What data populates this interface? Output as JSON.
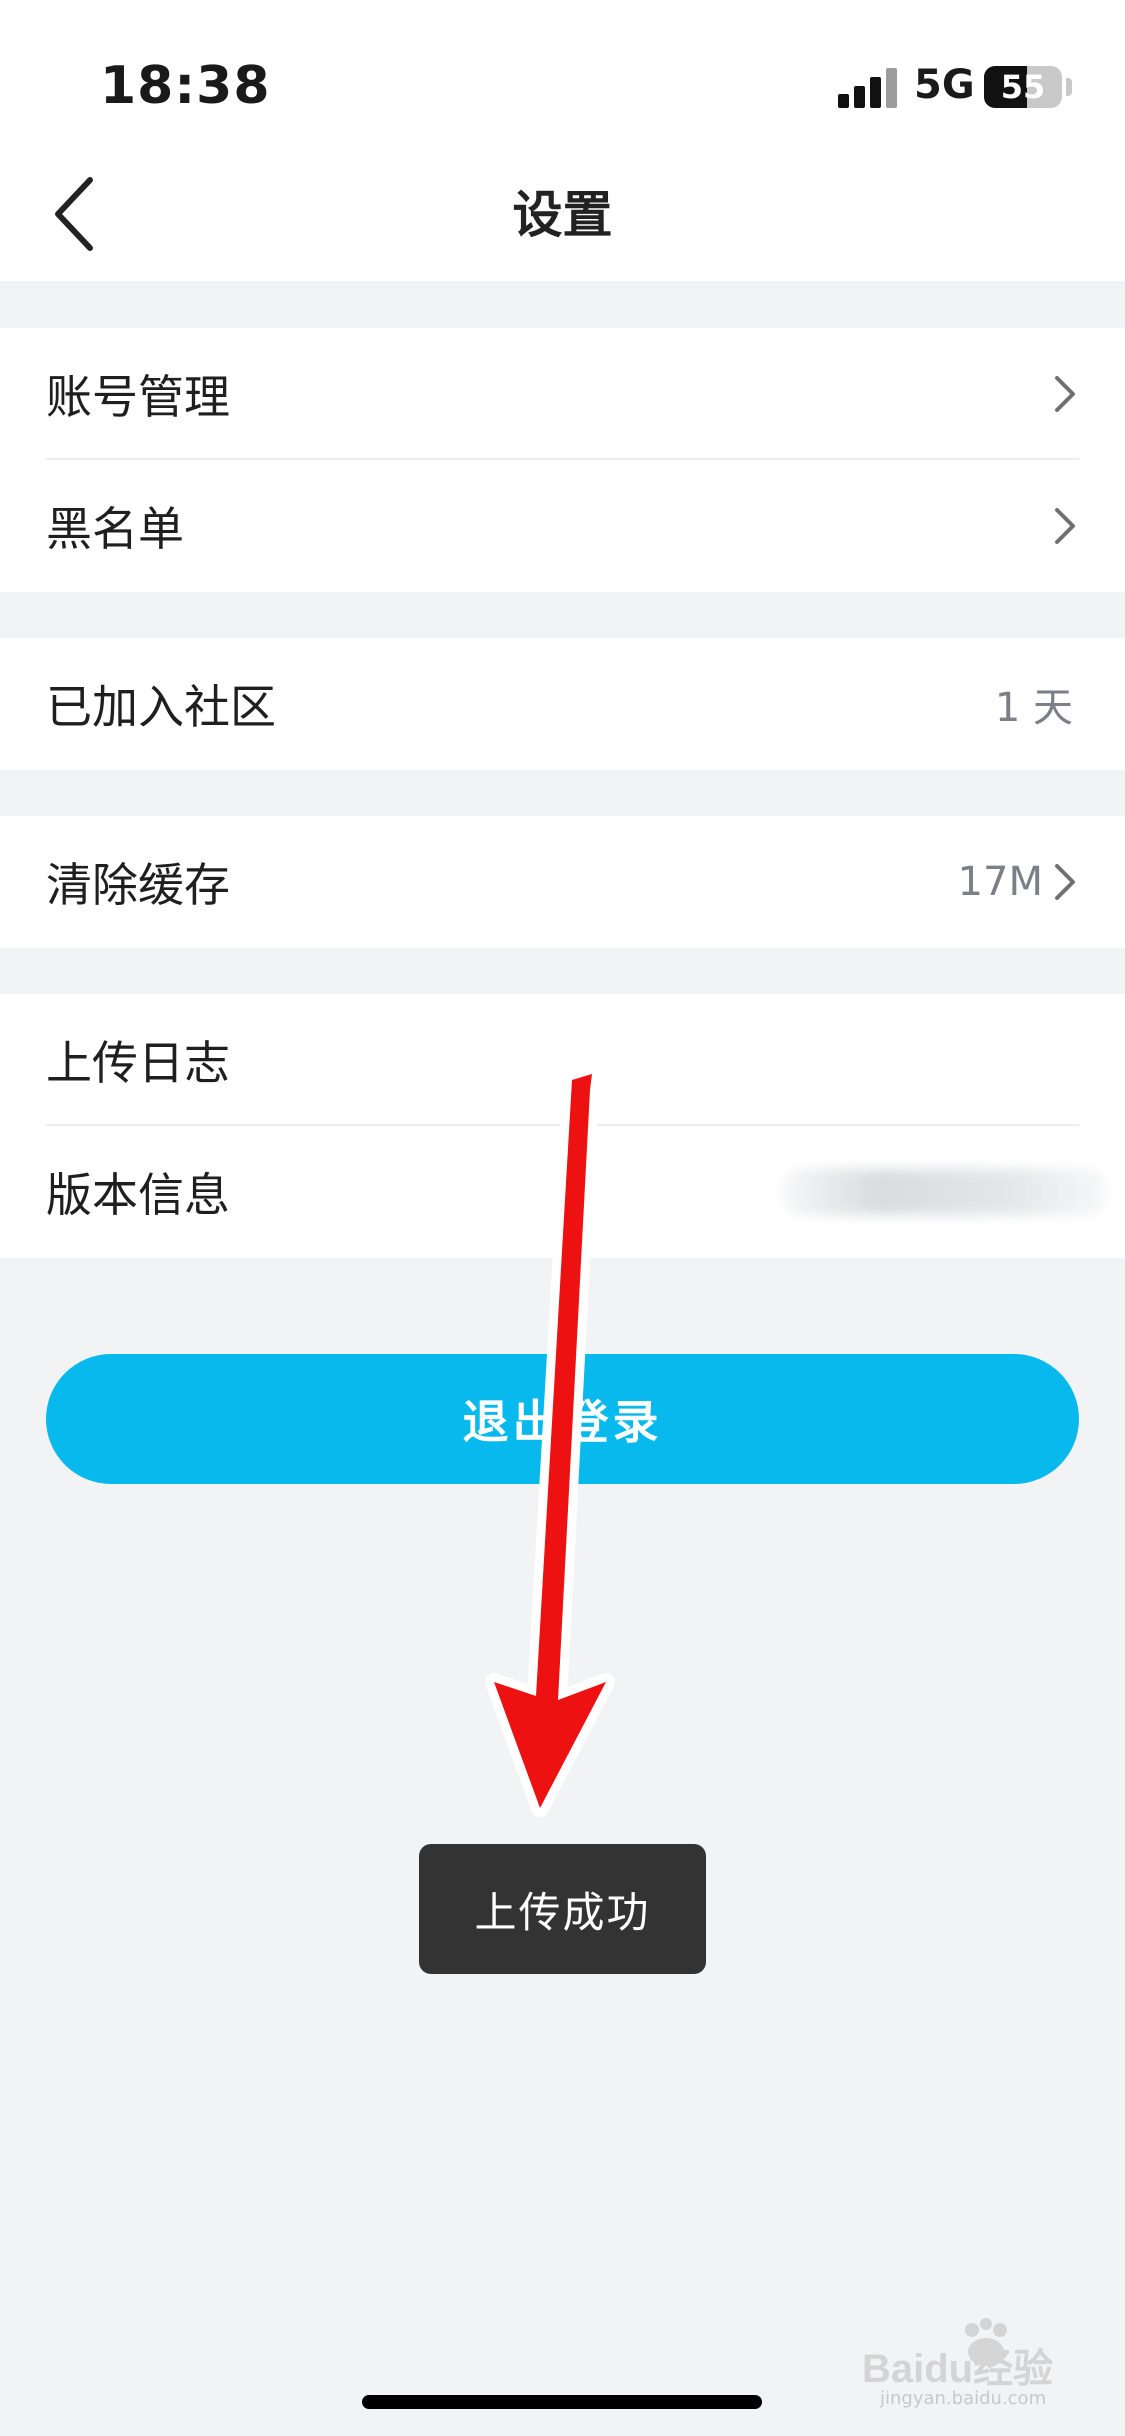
{
  "status_bar": {
    "time": "18:38",
    "network": "5G",
    "battery_level": "55"
  },
  "header": {
    "title": "设置",
    "back_icon": "chevron-left-icon"
  },
  "groups": [
    {
      "items": [
        {
          "label": "账号管理",
          "value": "",
          "chevron": true
        },
        {
          "label": "黑名单",
          "value": "",
          "chevron": true
        }
      ]
    },
    {
      "items": [
        {
          "label": "已加入社区",
          "value": "1 天",
          "chevron": false
        }
      ]
    },
    {
      "items": [
        {
          "label": "清除缓存",
          "value": "17M",
          "chevron": true
        }
      ]
    },
    {
      "items": [
        {
          "label": "上传日志",
          "value": "",
          "chevron": false
        },
        {
          "label": "版本信息",
          "value": "",
          "chevron": false,
          "value_obscured": true
        }
      ]
    }
  ],
  "logout_label": "退出登录",
  "toast": "上传成功",
  "watermark": {
    "brand": "Baidu经验",
    "url": "jingyan.baidu.com"
  },
  "colors": {
    "accent": "#07b9ec",
    "background": "#f2f3f5",
    "toast_bg": "#333333",
    "annotation_arrow": "#ee1111"
  }
}
